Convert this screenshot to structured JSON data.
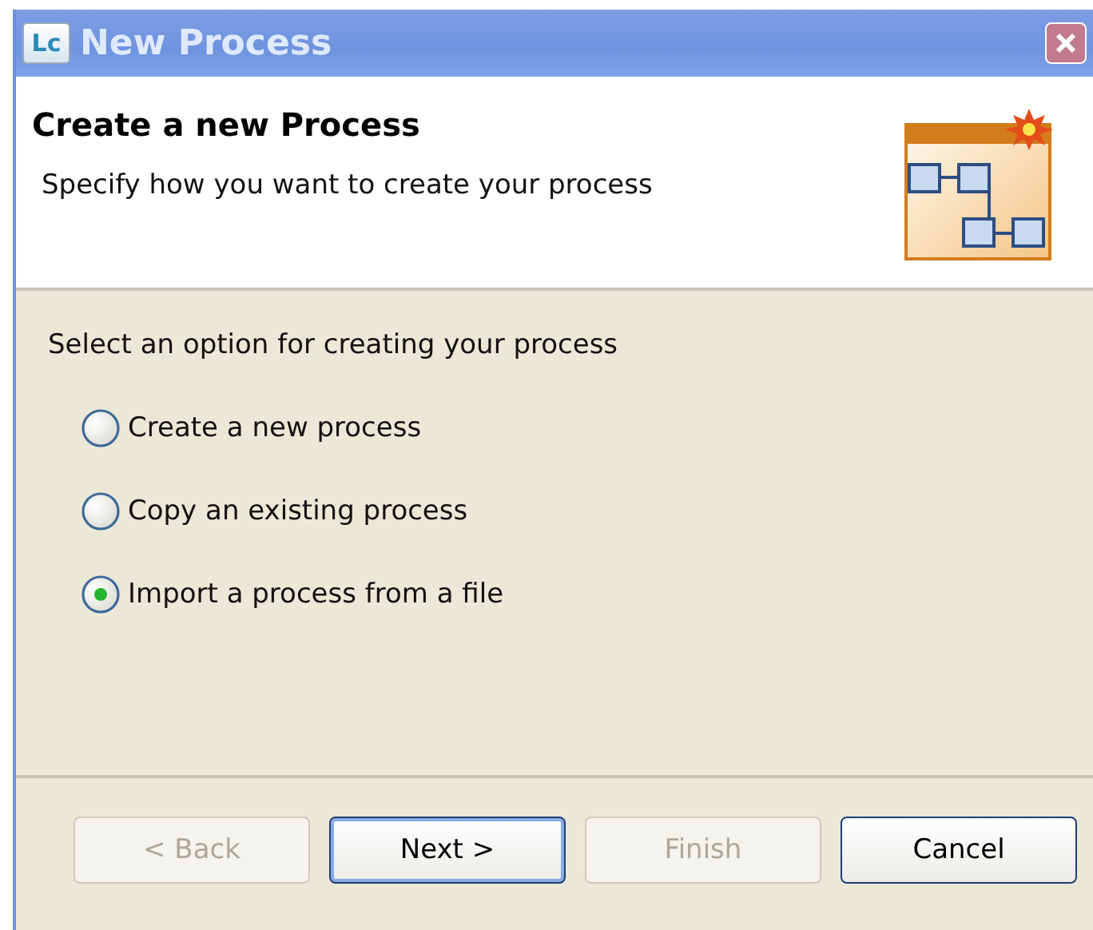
{
  "window": {
    "title": "New Process",
    "app_badge": "Lc"
  },
  "header": {
    "title": "Create a new Process",
    "description": "Specify how you want to create your process"
  },
  "options": {
    "label": "Select an option for creating your process",
    "items": [
      {
        "label": "Create a new process",
        "selected": false
      },
      {
        "label": "Copy an existing process",
        "selected": false
      },
      {
        "label": "Import a process from a file",
        "selected": true
      }
    ]
  },
  "buttons": [
    {
      "label": "< Back",
      "disabled": true,
      "default": false
    },
    {
      "label": "Next >",
      "disabled": false,
      "default": true
    },
    {
      "label": "Finish",
      "disabled": true,
      "default": false
    },
    {
      "label": "Cancel",
      "disabled": false,
      "default": false
    }
  ]
}
